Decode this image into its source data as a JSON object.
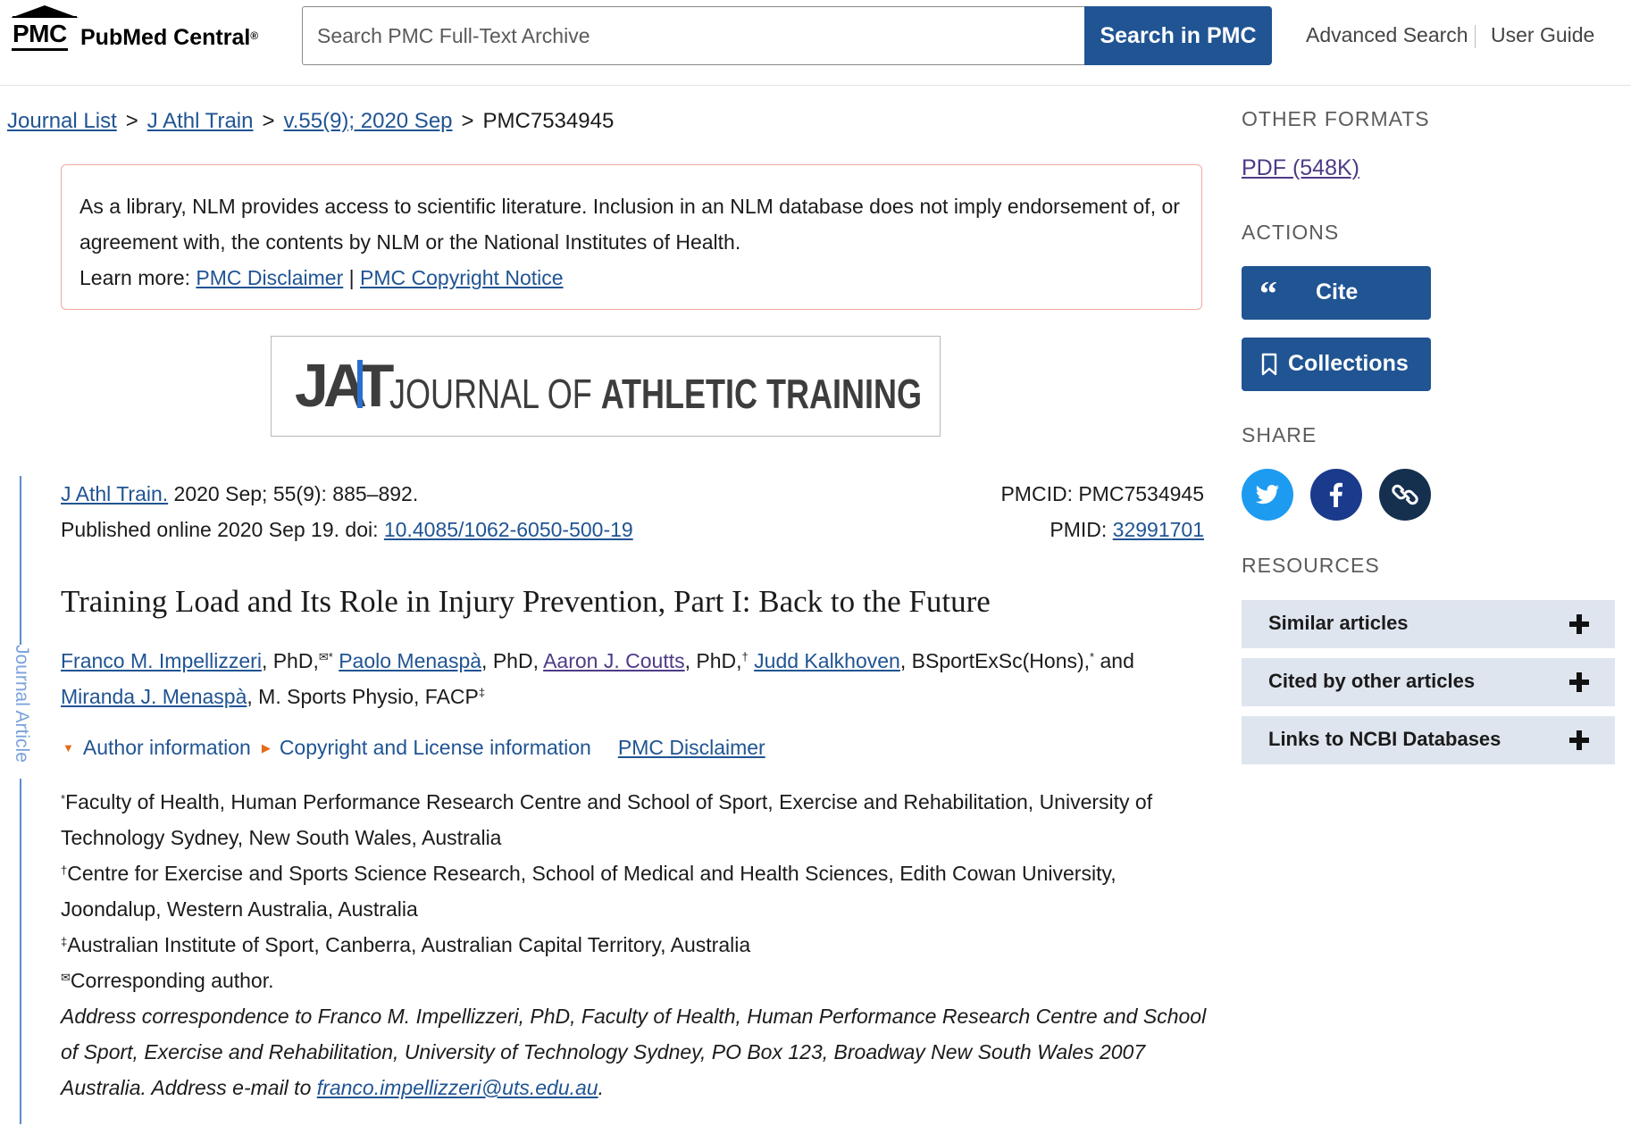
{
  "header": {
    "logo_short": "PMC",
    "logo_name": "PubMed Central",
    "logo_reg": "®",
    "search_placeholder": "Search PMC Full-Text Archive",
    "search_button": "Search in PMC",
    "advanced_search": "Advanced Search",
    "user_guide": "User Guide"
  },
  "breadcrumb": {
    "items": [
      "Journal List",
      "J Athl Train",
      "v.55(9); 2020 Sep"
    ],
    "separator": ">",
    "current": "PMC7534945"
  },
  "disclaimer": {
    "text": "As a library, NLM provides access to scientific literature. Inclusion in an NLM database does not imply endorsement of, or agreement with, the contents by NLM or the National Institutes of Health.",
    "learn_more": "Learn more:",
    "link1": "PMC Disclaimer",
    "divider": "|",
    "link2": "PMC Copyright Notice"
  },
  "banner": {
    "logo_letters": "JAT",
    "journal_name_part1": "JOURNAL OF ",
    "journal_name_part2": "ATHLETIC TRAINING"
  },
  "strip_label": "Journal Article",
  "citation": {
    "journal_link": "J Athl Train.",
    "journal_rest": " 2020 Sep; 55(9): 885–892.",
    "published": "Published online 2020 Sep 19. doi: ",
    "doi": "10.4085/1062-6050-500-19",
    "pmcid_label": "PMCID: ",
    "pmcid": "PMC7534945",
    "pmid_label": "PMID: ",
    "pmid": "32991701"
  },
  "article": {
    "title": "Training Load and Its Role in Injury Prevention, Part I: Back to the Future",
    "authors": [
      {
        "name": "Franco M. Impellizzeri",
        "suffix": ", PhD,",
        "sup": "✉*"
      },
      {
        "name": "Paolo Menaspà",
        "suffix": ", PhD, ",
        "sup": ""
      },
      {
        "name": "Aaron J. Coutts",
        "suffix": ", PhD,",
        "sup": "†"
      },
      {
        "name": "Judd Kalkhoven",
        "suffix": ", BSportExSc(Hons),",
        "sup": "*"
      },
      {
        "name": "Miranda J. Menaspà",
        "suffix": ", M. Sports Physio, FACP",
        "sup": "‡"
      }
    ],
    "and_word": " and",
    "toggle_author": "Author information",
    "toggle_copyright": "Copyright and License information",
    "pmc_disclaimer": "PMC Disclaimer"
  },
  "affiliations": {
    "a1_mark": "*",
    "a1": "Faculty of Health, Human Performance Research Centre and School of Sport, Exercise and Rehabilitation, University of Technology Sydney, New South Wales, Australia",
    "a2_mark": "†",
    "a2": "Centre for Exercise and Sports Science Research, School of Medical and Health Sciences, Edith Cowan University, Joondalup, Western Australia, Australia",
    "a3_mark": "‡",
    "a3": "Australian Institute of Sport, Canberra, Australian Capital Territory, Australia",
    "corr_mark": "✉",
    "corr": "Corresponding author.",
    "address": "Address correspondence to Franco M. Impellizzeri, PhD, Faculty of Health, Human Performance Research Centre and School of Sport, Exercise and Rehabilitation, University of Technology Sydney, PO Box 123, Broadway New South Wales 2007 Australia. Address e-mail to ",
    "email": "franco.impellizzeri@uts.edu.au",
    "end": "."
  },
  "sidebar": {
    "other_formats": "OTHER FORMATS",
    "pdf": "PDF (548K)",
    "actions": "ACTIONS",
    "cite": "Cite",
    "collections": "Collections",
    "share": "SHARE",
    "resources": "RESOURCES",
    "accordions": [
      "Similar articles",
      "Cited by other articles",
      "Links to NCBI Databases"
    ]
  },
  "colors": {
    "primary": "#205493",
    "twitter": "#1d9bf0",
    "facebook": "#1a3a8c",
    "link_share": "#15304f",
    "disclaimer_border": "#f0a9a1",
    "accordion_bg": "#dfe5ef"
  }
}
